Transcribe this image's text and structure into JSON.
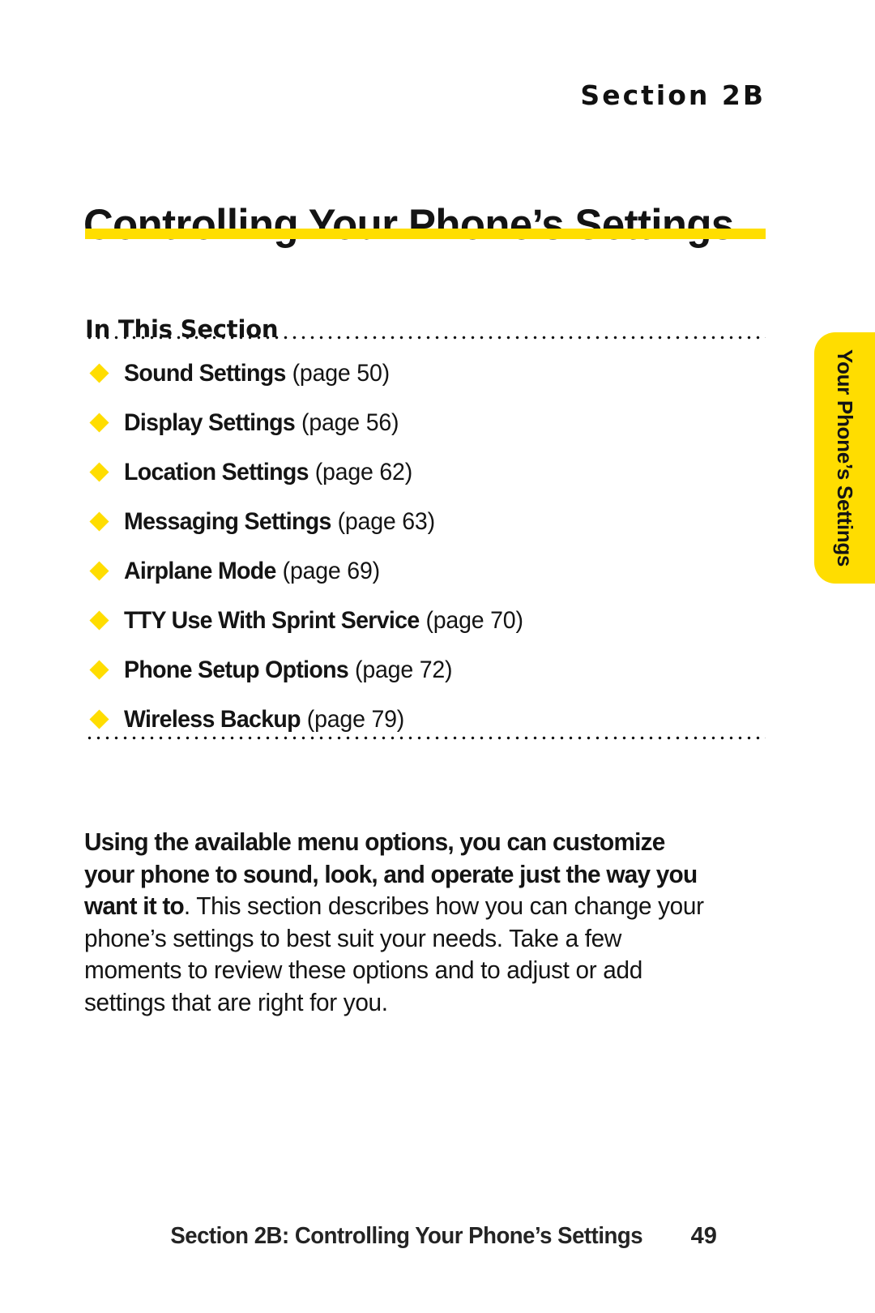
{
  "header": {
    "section_eyebrow": "Section 2B"
  },
  "title": {
    "text": "Controlling Your Phone’s Settings",
    "rule_color": "#ffde00"
  },
  "in_this_section": {
    "label": "In This Section",
    "items": [
      {
        "label": "Sound Settings",
        "page_ref": "(page 50)"
      },
      {
        "label": "Display Settings",
        "page_ref": "(page 56)"
      },
      {
        "label": "Location Settings",
        "page_ref": "(page 62)"
      },
      {
        "label": "Messaging Settings",
        "page_ref": "(page 63)"
      },
      {
        "label": "Airplane Mode",
        "page_ref": "(page 69)"
      },
      {
        "label": "TTY Use With Sprint Service",
        "page_ref": "(page 70)"
      },
      {
        "label": "Phone Setup Options",
        "page_ref": "(page 72)"
      },
      {
        "label": "Wireless Backup",
        "page_ref": "(page 79)"
      }
    ],
    "bullet_color": "#ffdd00"
  },
  "side_tab": {
    "label": "Your Phone’s Settings",
    "background_color": "#ffdd00"
  },
  "body": {
    "lead": "Using the available menu options, you can customize your phone to sound, look, and operate just the way you want it to",
    "rest": ". This section describes how you can change your phone’s settings to best suit your needs. Take a few moments to review these options and to adjust or add settings that are right for you."
  },
  "footer": {
    "title": "Section 2B: Controlling Your Phone’s Settings",
    "page_number": "49"
  }
}
